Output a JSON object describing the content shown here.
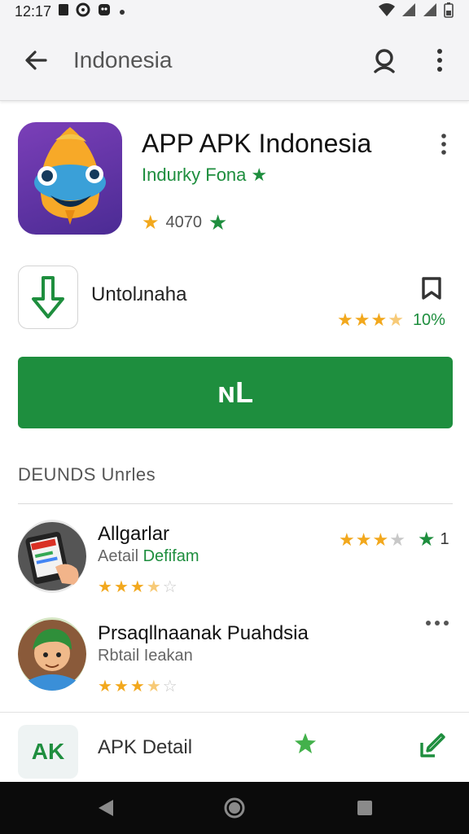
{
  "status_bar": {
    "time": "12:17"
  },
  "app_bar": {
    "title": "Indonesia"
  },
  "app": {
    "title": "APP APK Indonesia",
    "developer": "Indurky Fona",
    "rating_count": "4070"
  },
  "download": {
    "label": "Untolɹnaha",
    "percent": "10%",
    "stars_filled": 3.5
  },
  "install": {
    "label": "ɴL"
  },
  "section": {
    "title": "DEUNDS  Unrles"
  },
  "list": [
    {
      "title": "Allgarlar",
      "sub_prefix": "Aetail ",
      "sub_accent": "Defifam",
      "rating": 3.5,
      "right_trailing": "1"
    },
    {
      "title": "Prsaqllnaanak Puahdsia",
      "sub_prefix": "Rbtail Ieakan",
      "sub_accent": "",
      "rating": 3.5
    }
  ],
  "bottom": {
    "badge": "AK",
    "label": "APK Detail"
  },
  "colors": {
    "accent": "#1e8e3e",
    "star": "#f2a81d",
    "icon_bg": "#5b2fa3"
  }
}
